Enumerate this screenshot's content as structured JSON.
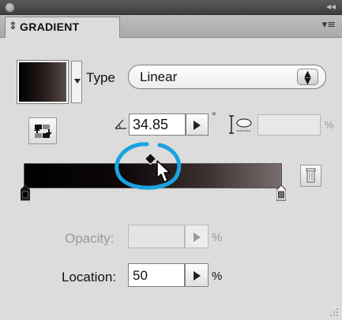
{
  "window": {
    "collapse_glyph": "◂◂"
  },
  "panel": {
    "tab_arrows": "⇕",
    "title": "GRADIENT",
    "menu_glyph": "▾≡"
  },
  "type": {
    "label": "Type",
    "value": "Linear",
    "stepper_glyph": "▲▼"
  },
  "angle": {
    "value": "34.85",
    "unit": "°"
  },
  "aspect_ratio": {
    "value": "",
    "unit": "%"
  },
  "gradient": {
    "start_color": "#000000",
    "end_color": "#7a6d6d",
    "midpoint_location_percent": 50
  },
  "opacity": {
    "label": "Opacity:",
    "value": "",
    "unit": "%"
  },
  "location": {
    "label": "Location:",
    "value": "50",
    "unit": "%"
  },
  "colors": {
    "highlight_ring": "#1aa3e0",
    "panel_bg": "#dcdcdc"
  },
  "icons": {
    "reverse": "reverse-gradient-icon",
    "angle": "angle-icon",
    "aspect": "aspect-ratio-icon",
    "trash": "trash-icon",
    "cursor": "arrow-cursor-icon"
  }
}
